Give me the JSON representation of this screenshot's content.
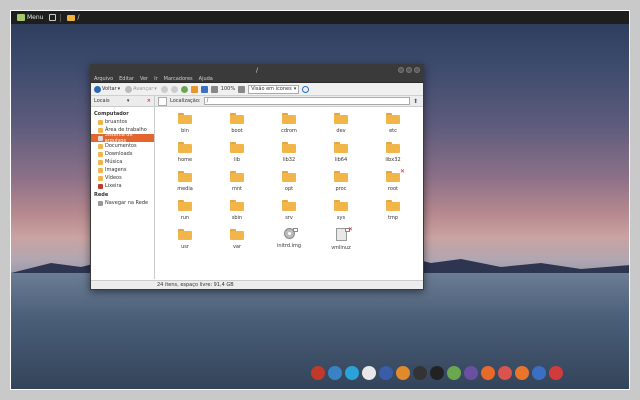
{
  "top_panel": {
    "menu_label": "Menu",
    "path_label": "/",
    "icons": [
      "mint-logo-icon",
      "terminal-icon",
      "folder-icon"
    ]
  },
  "window": {
    "title": "/",
    "menus": [
      "Arquivo",
      "Editar",
      "Ver",
      "Ir",
      "Marcadores",
      "Ajuda"
    ],
    "toolbar": {
      "back": "Voltar",
      "forward": "Avançar",
      "zoom": "100%",
      "view": "Visão em ícones"
    },
    "places_header": "Locais",
    "location_label": "Localização:",
    "location_value": "/",
    "sidebar": {
      "sections": [
        {
          "title": "Computador",
          "items": [
            {
              "label": "bruantos",
              "icon": "home-icon",
              "color": "#f2b54a",
              "active": false
            },
            {
              "label": "Área de trabalho",
              "icon": "desktop-icon",
              "color": "#f2b54a",
              "active": false
            },
            {
              "label": "Sistema de arquivos",
              "icon": "drive-icon",
              "color": "#ddd",
              "active": true
            },
            {
              "label": "Documentos",
              "icon": "documents-icon",
              "color": "#f2b54a",
              "active": false
            },
            {
              "label": "Downloads",
              "icon": "downloads-icon",
              "color": "#f2b54a",
              "active": false
            },
            {
              "label": "Música",
              "icon": "music-icon",
              "color": "#f2b54a",
              "active": false
            },
            {
              "label": "Imagens",
              "icon": "pictures-icon",
              "color": "#f2b54a",
              "active": false
            },
            {
              "label": "Vídeos",
              "icon": "videos-icon",
              "color": "#f2b54a",
              "active": false
            },
            {
              "label": "Lixeira",
              "icon": "trash-icon",
              "color": "#c0392b",
              "active": false
            }
          ]
        },
        {
          "title": "Rede",
          "items": [
            {
              "label": "Navegar na Rede",
              "icon": "network-icon",
              "color": "#999",
              "active": false
            }
          ]
        }
      ]
    },
    "files": [
      {
        "name": "bin",
        "type": "folder"
      },
      {
        "name": "boot",
        "type": "folder"
      },
      {
        "name": "cdrom",
        "type": "folder"
      },
      {
        "name": "dev",
        "type": "folder"
      },
      {
        "name": "etc",
        "type": "folder"
      },
      {
        "name": "home",
        "type": "folder"
      },
      {
        "name": "lib",
        "type": "folder"
      },
      {
        "name": "lib32",
        "type": "folder"
      },
      {
        "name": "lib64",
        "type": "folder"
      },
      {
        "name": "libx32",
        "type": "folder"
      },
      {
        "name": "media",
        "type": "folder"
      },
      {
        "name": "mnt",
        "type": "folder"
      },
      {
        "name": "opt",
        "type": "folder"
      },
      {
        "name": "proc",
        "type": "folder"
      },
      {
        "name": "root",
        "type": "folder",
        "locked": true
      },
      {
        "name": "run",
        "type": "folder"
      },
      {
        "name": "sbin",
        "type": "folder"
      },
      {
        "name": "srv",
        "type": "folder"
      },
      {
        "name": "sys",
        "type": "folder"
      },
      {
        "name": "tmp",
        "type": "folder"
      },
      {
        "name": "usr",
        "type": "folder"
      },
      {
        "name": "var",
        "type": "folder"
      },
      {
        "name": "initrd.img",
        "type": "disc"
      },
      {
        "name": "vmlinuz",
        "type": "file",
        "locked": true
      }
    ],
    "status": "24 itens, espaço livre: 91,4 GB"
  },
  "dock": [
    {
      "name": "anchor-icon",
      "color": "#c0392b"
    },
    {
      "name": "chromium-icon",
      "color": "#3b82c4"
    },
    {
      "name": "telegram-icon",
      "color": "#2aa3d8"
    },
    {
      "name": "files-icon",
      "color": "#e8e8e8"
    },
    {
      "name": "tweak-icon",
      "color": "#3b5da8"
    },
    {
      "name": "sublime-icon",
      "color": "#e08a2b"
    },
    {
      "name": "steam-icon",
      "color": "#333"
    },
    {
      "name": "terminal-icon",
      "color": "#222"
    },
    {
      "name": "green-app-icon",
      "color": "#6aa84f"
    },
    {
      "name": "purple-app-icon",
      "color": "#6b4fa3"
    },
    {
      "name": "firefox-icon",
      "color": "#e86a2b"
    },
    {
      "name": "books-icon",
      "color": "#d9534f"
    },
    {
      "name": "orange-app-icon",
      "color": "#e8752b"
    },
    {
      "name": "chart-app-icon",
      "color": "#3b6fc4"
    },
    {
      "name": "shirt-icon",
      "color": "#d23b3b"
    }
  ]
}
